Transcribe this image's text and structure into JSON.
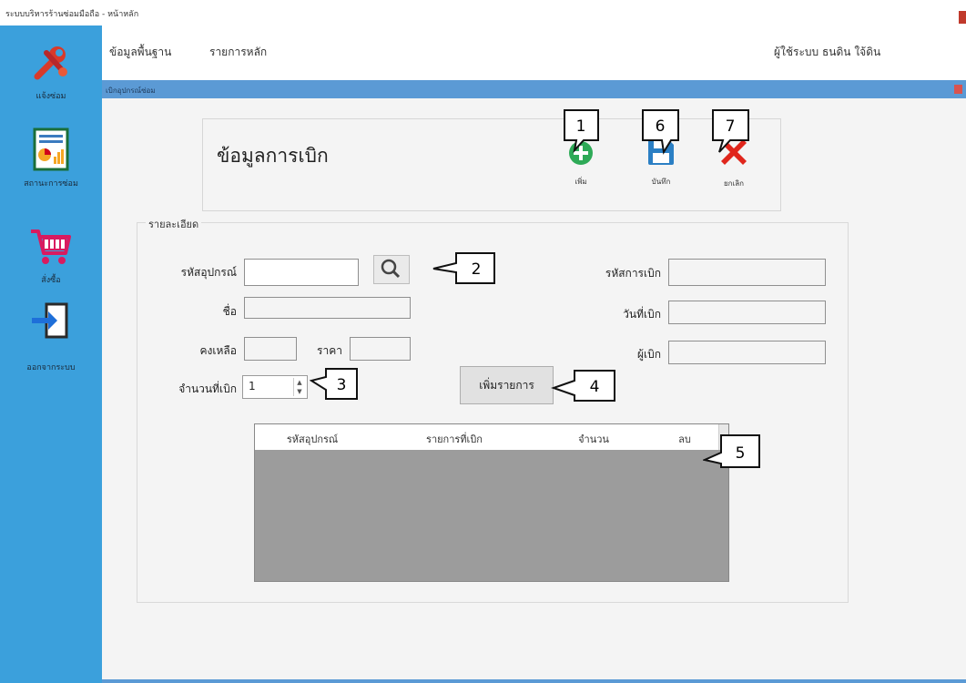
{
  "window": {
    "title": "ระบบบริหารร้านซ่อมมือถือ - หน้าหลัก"
  },
  "sidebar": {
    "items": [
      {
        "label": "แจ้งซ่อม",
        "icon": "repair-tools-icon"
      },
      {
        "label": "สถานะการซ่อม",
        "icon": "report-chart-icon"
      },
      {
        "label": "สั่งซื้อ",
        "icon": "shopping-cart-icon"
      },
      {
        "label": "ออกจากระบบ",
        "icon": "logout-icon"
      }
    ]
  },
  "menu": {
    "items": [
      "ข้อมูลพื้นฐาน",
      "รายการหลัก"
    ],
    "user": "ผู้ใช้ระบบ ธนดิน ใจ้ดิน"
  },
  "form": {
    "title": "เบิกอุปกรณ์ซ่อม",
    "heading": "ข้อมูลการเบิก",
    "toolbar": {
      "add_label": "เพิ่ม",
      "save_label": "บันทึก",
      "cancel_label": "ยกเลิก"
    },
    "details": {
      "legend": "รายละเอียด",
      "equipment_code_label": "รหัสอุปกรณ์",
      "name_label": "ชื่อ",
      "remaining_label": "คงเหลือ",
      "price_label": "ราคา",
      "quantity_label": "จำนวนที่เบิก",
      "quantity_value": "1",
      "withdraw_code_label": "รหัสการเบิก",
      "withdraw_date_label": "วันที่เบิก",
      "withdrawer_label": "ผู้เบิก",
      "add_item_label": "เพิ่มรายการ"
    },
    "grid": {
      "columns": [
        "รหัสอุปกรณ์",
        "รายการที่เบิก",
        "จำนวน",
        "ลบ"
      ]
    }
  },
  "callouts": [
    "1",
    "2",
    "3",
    "4",
    "5",
    "6",
    "7"
  ],
  "colors": {
    "sidebar": "#3ba0dc",
    "header": "#5b9ad5",
    "add": "#2eaa57",
    "save": "#2b7fc4",
    "cancel": "#e0261c"
  }
}
